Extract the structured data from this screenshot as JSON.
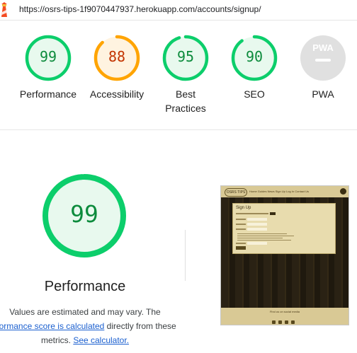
{
  "header": {
    "url": "https://osrs-tips-1f9070447937.herokuapp.com/accounts/signup/"
  },
  "gauges": [
    {
      "label": "Performance",
      "score": "99",
      "value": 0.99,
      "color": "#0cce6b",
      "fill": "#e8f9ee",
      "text_color": "#0c8b3c"
    },
    {
      "label": "Accessibility",
      "score": "88",
      "value": 0.88,
      "color": "#ffa400",
      "fill": "#fff3e0",
      "text_color": "#c33300"
    },
    {
      "label_lines": [
        "Best",
        "Practices"
      ],
      "score": "95",
      "value": 0.95,
      "color": "#0cce6b",
      "fill": "#e8f9ee",
      "text_color": "#0c8b3c"
    },
    {
      "label": "SEO",
      "score": "90",
      "value": 0.9,
      "color": "#0cce6b",
      "fill": "#e8f9ee",
      "text_color": "#0c8b3c"
    },
    {
      "label": "PWA",
      "badge": "PWA",
      "color": "#e0e0e0",
      "fill": "#e0e0e0"
    }
  ],
  "main": {
    "score": "99",
    "value": 0.99,
    "title": "Performance",
    "desc_line1": "Values are estimated and may vary. The",
    "link_score_calc": "rformance score is calculated",
    "desc_line2_rest": " directly from these",
    "desc_line3_prefix": "metrics. ",
    "link_calculator": "See calculator."
  },
  "thumbnail": {
    "nav_logo": "OSRS TIPS",
    "nav_links": "Home   Guides   News   Sign Up   Log In   Contact Us",
    "card_title": "Sign Up",
    "footer_text": "Find us on social media"
  }
}
